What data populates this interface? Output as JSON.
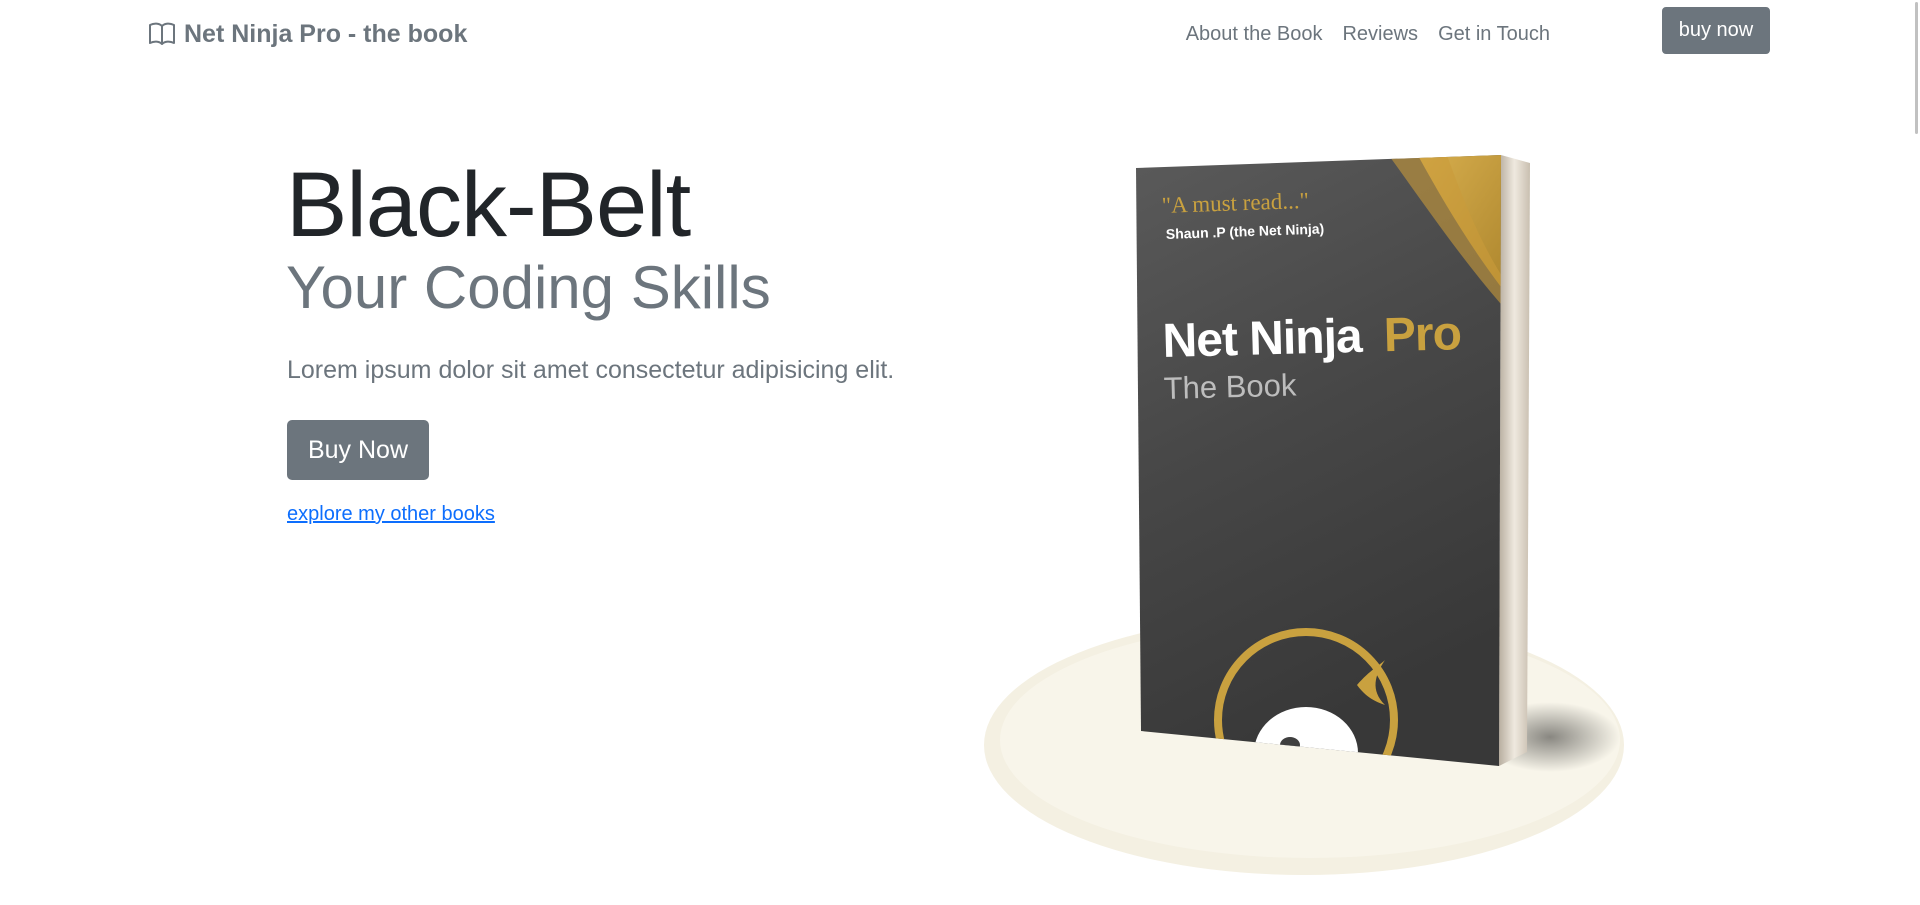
{
  "nav": {
    "brand": "Net Ninja Pro - the book",
    "links": [
      "About the Book",
      "Reviews",
      "Get in Touch"
    ],
    "buy_label": "buy now"
  },
  "hero": {
    "title": "Black-Belt",
    "subtitle": "Your Coding Skills",
    "lead": "Lorem ipsum dolor sit amet consectetur adipisicing elit.",
    "buy_label": "Buy Now",
    "other_books_link": "explore my other books"
  },
  "book": {
    "quote": "\"A must read...\"",
    "quote_author": "Shaun .P (the Net Ninja)",
    "title_part1": "Net Ninja",
    "title_part2": "Pro",
    "subtitle": "The Book"
  },
  "colors": {
    "accent_gray": "#6c757d",
    "link_blue": "#0d6efd",
    "gold": "#c9a13f",
    "cover_dark": "#3f3f3f"
  }
}
